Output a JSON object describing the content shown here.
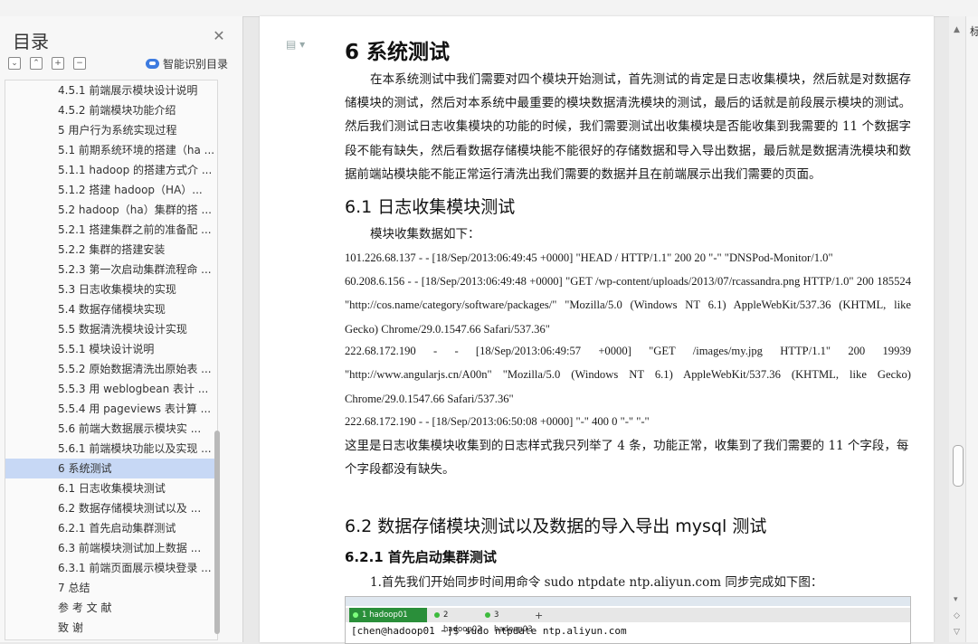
{
  "nav": {
    "title": "目录",
    "smart_label": "智能识别目录",
    "toc": [
      {
        "label": "4.5.1  前端展示模块设计说明",
        "active": false
      },
      {
        "label": "4.5.2  前端模块功能介绍",
        "active": false
      },
      {
        "label": "5  用户行为系统实现过程",
        "active": false
      },
      {
        "label": "5.1 前期系统环境的搭建（ha ...",
        "active": false
      },
      {
        "label": "5.1.1 hadoop 的搭建方式介 ...",
        "active": false
      },
      {
        "label": "5.1.2  搭建 hadoop（HA）...",
        "active": false
      },
      {
        "label": "5.2 hadoop（ha）集群的搭 ...",
        "active": false
      },
      {
        "label": "5.2.1  搭建集群之前的准备配 ...",
        "active": false
      },
      {
        "label": "5.2.2  集群的搭建安装",
        "active": false
      },
      {
        "label": "5.2.3  第一次启动集群流程命 ...",
        "active": false
      },
      {
        "label": "5.3  日志收集模块的实现",
        "active": false
      },
      {
        "label": "5.4  数据存储模块实现",
        "active": false
      },
      {
        "label": "5.5  数据清洗模块设计实现",
        "active": false
      },
      {
        "label": "5.5.1  模块设计说明",
        "active": false
      },
      {
        "label": "5.5.2 原始数据清洗出原始表 ...",
        "active": false
      },
      {
        "label": "5.5.3  用 weblogbean 表计 ...",
        "active": false
      },
      {
        "label": "5.5.4  用 pageviews 表计算 ...",
        "active": false
      },
      {
        "label": "5.6  前端大数据展示模块实 ...",
        "active": false
      },
      {
        "label": "5.6.1  前端模块功能以及实现 ...",
        "active": false
      },
      {
        "label": "6  系统测试",
        "active": true
      },
      {
        "label": "6.1 日志收集模块测试",
        "active": false
      },
      {
        "label": "6.2  数据存储模块测试以及 ...",
        "active": false
      },
      {
        "label": "6.2.1  首先启动集群测试",
        "active": false
      },
      {
        "label": "6.3  前端模块测试加上数据 ...",
        "active": false
      },
      {
        "label": "6.3.1 前端页面展示模块登录 ...",
        "active": false
      },
      {
        "label": "7  总结",
        "active": false
      },
      {
        "label": "参 考 文 献",
        "active": false
      },
      {
        "label": "致    谢",
        "active": false
      }
    ]
  },
  "doc": {
    "h1": "6  系统测试",
    "intro": "在本系统测试中我们需要对四个模块开始测试，首先测试的肯定是日志收集模块，然后就是对数据存储模块的测试，然后对本系统中最重要的模块数据清洗模块的测试，最后的话就是前段展示模块的测试。然后我们测试日志收集模块的功能的时候，我们需要测试出收集模块是否能收集到我需要的 11 个数据字段不能有缺失，然后看数据存储模块能不能很好的存储数据和导入导出数据，最后就是数据清洗模块和数据前端站模块能不能正常运行清洗出我们需要的数据并且在前端展示出我们需要的页面。",
    "h2_1": "6.1 日志收集模块测试",
    "collect_intro": "模块收集数据如下：",
    "log1": "101.226.68.137 - - [18/Sep/2013:06:49:45 +0000] \"HEAD / HTTP/1.1\" 200 20 \"-\" \"DNSPod-Monitor/1.0\"",
    "log2": "60.208.6.156 - - [18/Sep/2013:06:49:48 +0000] \"GET /wp-content/uploads/2013/07/rcassandra.png HTTP/1.0\" 200 185524 \"http://cos.name/category/software/packages/\" \"Mozilla/5.0 (Windows NT 6.1) AppleWebKit/537.36 (KHTML, like Gecko) Chrome/29.0.1547.66 Safari/537.36\"",
    "log3": "222.68.172.190 - - [18/Sep/2013:06:49:57 +0000] \"GET /images/my.jpg HTTP/1.1\" 200 19939 \"http://www.angularjs.cn/A00n\" \"Mozilla/5.0 (Windows NT 6.1) AppleWebKit/537.36 (KHTML, like Gecko) Chrome/29.0.1547.66 Safari/537.36\"",
    "log4": "222.68.172.190 - - [18/Sep/2013:06:50:08 +0000] \"-\" 400 0 \"-\" \"-\"",
    "summary": "这里是日志收集模块收集到的日志样式我只列举了 4 条，功能正常，收集到了我们需要的 11 个字段，每个字段都没有缺失。",
    "h2_2": "6.2  数据存储模块测试以及数据的导入导出 mysql 测试",
    "h3_1": "6.2.1  首先启动集群测试",
    "step1": "1.首先我们开始同步时间用命令  sudo ntpdate ntp.aliyun.com  同步完成如下图："
  },
  "terminal": {
    "tabs": [
      "1 hadoop01",
      "2 hadoop02",
      "3 hadoop03"
    ],
    "command": "[chen@hadoop01 ~]$ sudo ntpdate ntp.aliyun.com"
  },
  "side": {
    "label": "标"
  }
}
